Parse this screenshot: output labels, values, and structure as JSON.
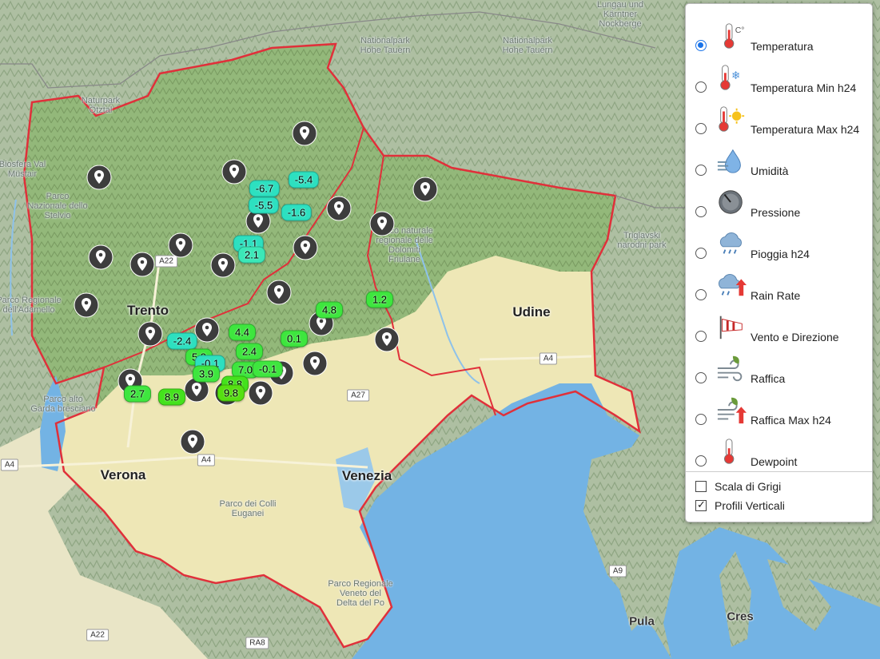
{
  "map": {
    "cities": [
      {
        "name": "Trento"
      },
      {
        "name": "Udine"
      },
      {
        "name": "Verona"
      },
      {
        "name": "Venezia"
      },
      {
        "name": "Pula"
      },
      {
        "name": "Cres"
      }
    ],
    "parks": [
      "Naturpark\nÖtztal",
      "Nationalpark\nHohe Tauern",
      "Nationalpark\nHohe Tauern",
      "Lungau und\nKärntner\nNockberge",
      "Parco\nNazionale dello\nStelvio",
      "Parco naturale\nregionale delle\nDolomiti\nFriulane",
      "Triglavski\nnarodni park",
      "Parco Regionale\ndell'Adamello",
      "Parco alto\nGarda bresciano",
      "Parco dei Colli\nEuganei",
      "Parco Regionale\nVeneto del\nDelta del Po",
      "Biosfera Val\nMüstair"
    ],
    "roads": [
      "A22",
      "A4",
      "A27",
      "A4",
      "A4",
      "A9",
      "A22",
      "RA8"
    ],
    "badges": [
      {
        "value": "-5.4",
        "color": "#2de0c0"
      },
      {
        "value": "-6.7",
        "color": "#2de0c0"
      },
      {
        "value": "-5.5",
        "color": "#2de0c0"
      },
      {
        "value": "-1.6",
        "color": "#2de0c0"
      },
      {
        "value": "-1.1",
        "color": "#2de0c0"
      },
      {
        "value": "2.1",
        "color": "#3be8b8"
      },
      {
        "value": "4.8",
        "color": "#3ee63e"
      },
      {
        "value": "1.2",
        "color": "#3ee63e"
      },
      {
        "value": "4.4",
        "color": "#3ee63e"
      },
      {
        "value": "-2.4",
        "color": "#2de0c0"
      },
      {
        "value": "0.1",
        "color": "#3ee63e"
      },
      {
        "value": "2.4",
        "color": "#3ee63e"
      },
      {
        "value": "5.8",
        "color": "#3ee63e"
      },
      {
        "value": "-0.1",
        "color": "#2de0c0"
      },
      {
        "value": "7.0",
        "color": "#3ee63e"
      },
      {
        "value": "-0.1",
        "color": "#3ee63e"
      },
      {
        "value": "3.9",
        "color": "#3ee63e"
      },
      {
        "value": "8.8",
        "color": "#44e21c"
      },
      {
        "value": "9.8",
        "color": "#55e010"
      },
      {
        "value": "2.7",
        "color": "#3ee63e"
      },
      {
        "value": "8.9",
        "color": "#44e21c"
      }
    ],
    "marker_icon": "map-pin-icon",
    "region_border_color": "#e0303a",
    "sea_color": "#73b3e4",
    "plain_color": "#efe8b5"
  },
  "panel": {
    "layers": [
      {
        "label": "Temperatura",
        "icon": "thermometer-celsius-icon",
        "selected": true
      },
      {
        "label": "Temperatura Min h24",
        "icon": "thermometer-snow-icon",
        "selected": false
      },
      {
        "label": "Temperatura Max h24",
        "icon": "thermometer-sun-icon",
        "selected": false
      },
      {
        "label": "Umidità",
        "icon": "humidity-drop-icon",
        "selected": false
      },
      {
        "label": "Pressione",
        "icon": "pressure-gauge-icon",
        "selected": false
      },
      {
        "label": "Pioggia h24",
        "icon": "rain-cloud-icon",
        "selected": false
      },
      {
        "label": "Rain Rate",
        "icon": "rain-rate-cloud-icon",
        "selected": false
      },
      {
        "label": "Vento e Direzione",
        "icon": "windsock-icon",
        "selected": false
      },
      {
        "label": "Raffica",
        "icon": "wind-gust-icon",
        "selected": false
      },
      {
        "label": "Raffica Max h24",
        "icon": "wind-gust-max-icon",
        "selected": false
      },
      {
        "label": "Dewpoint",
        "icon": "dewpoint-thermometer-icon",
        "selected": false
      }
    ],
    "options": [
      {
        "label": "Scala di Grigi",
        "checked": false
      },
      {
        "label": "Profili Verticali",
        "checked": true
      }
    ]
  }
}
